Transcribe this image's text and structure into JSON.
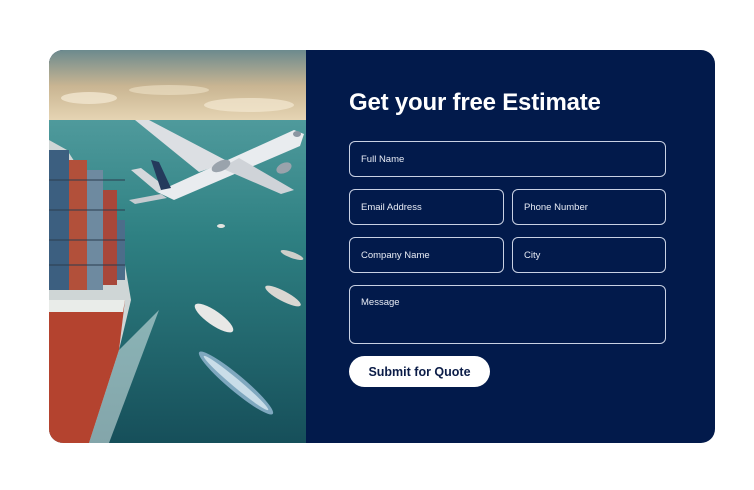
{
  "form": {
    "heading": "Get your free Estimate",
    "full_name_placeholder": "Full Name",
    "email_placeholder": "Email Address",
    "phone_placeholder": "Phone Number",
    "company_placeholder": "Company Name",
    "city_placeholder": "City",
    "message_placeholder": "Message",
    "submit_label": "Submit for Quote"
  },
  "colors": {
    "panel_background": "#021a4b",
    "page_background": "#ffffff",
    "button_background": "#ffffff",
    "button_text": "#0b1c47"
  },
  "image": {
    "subject": "cargo-ship-and-airplane-photo"
  }
}
